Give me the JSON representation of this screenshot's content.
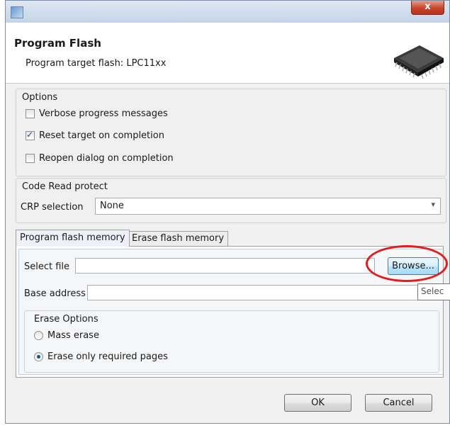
{
  "window": {
    "close_label": "x"
  },
  "header": {
    "title": "Program Flash",
    "subtitle": "Program target flash: LPC11xx"
  },
  "options": {
    "group_title": "Options",
    "items": [
      {
        "label": "Verbose progress messages",
        "checked": false
      },
      {
        "label": "Reset target on completion",
        "checked": true
      },
      {
        "label": "Reopen dialog on completion",
        "checked": false
      }
    ]
  },
  "crp": {
    "group_title": "Code Read protect",
    "label": "CRP selection",
    "value": "None"
  },
  "tabs": {
    "program": "Program flash memory",
    "erase": "Erase flash memory"
  },
  "program_tab": {
    "select_file_label": "Select file",
    "select_file_value": "",
    "browse_label": "Browse...",
    "base_address_label": "Base address",
    "base_address_value": "",
    "tooltip": "Selec",
    "erase_options": {
      "group_title": "Erase Options",
      "mass_erase": "Mass erase",
      "required_pages": "Erase only required pages",
      "selected": "required_pages"
    }
  },
  "buttons": {
    "ok": "OK",
    "cancel": "Cancel"
  },
  "colors": {
    "highlight": "#e01e1e",
    "accent": "#1b4f92"
  }
}
